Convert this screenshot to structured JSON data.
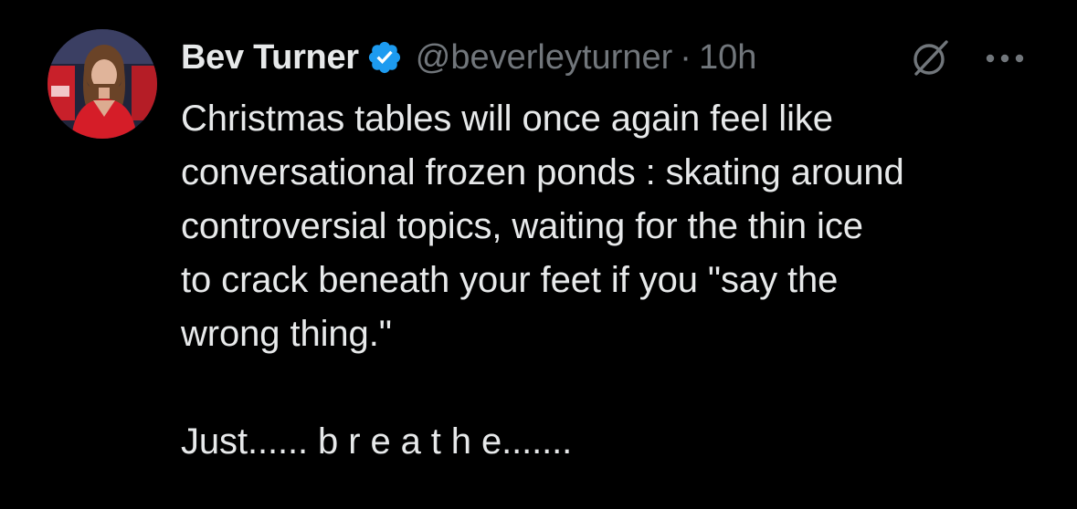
{
  "author": {
    "display_name": "Bev Turner",
    "handle": "@beverleyturner",
    "separator": "·",
    "time": "10h",
    "verified": true
  },
  "tweet": {
    "paragraph_1": "Christmas tables will once again feel like\nconversational frozen ponds : skating around\ncontroversial topics, waiting for the thin ice\nto crack beneath your feet if you \"say the\nwrong thing.\"",
    "paragraph_2": "Just...... b r e a t h e......."
  },
  "icons": {
    "verified": "verified-badge-icon",
    "grok": "grok-icon",
    "more": "more-options-icon"
  },
  "colors": {
    "background": "#000000",
    "text": "#e7e9ea",
    "secondary": "#71767b",
    "verified": "#1d9bf0"
  }
}
